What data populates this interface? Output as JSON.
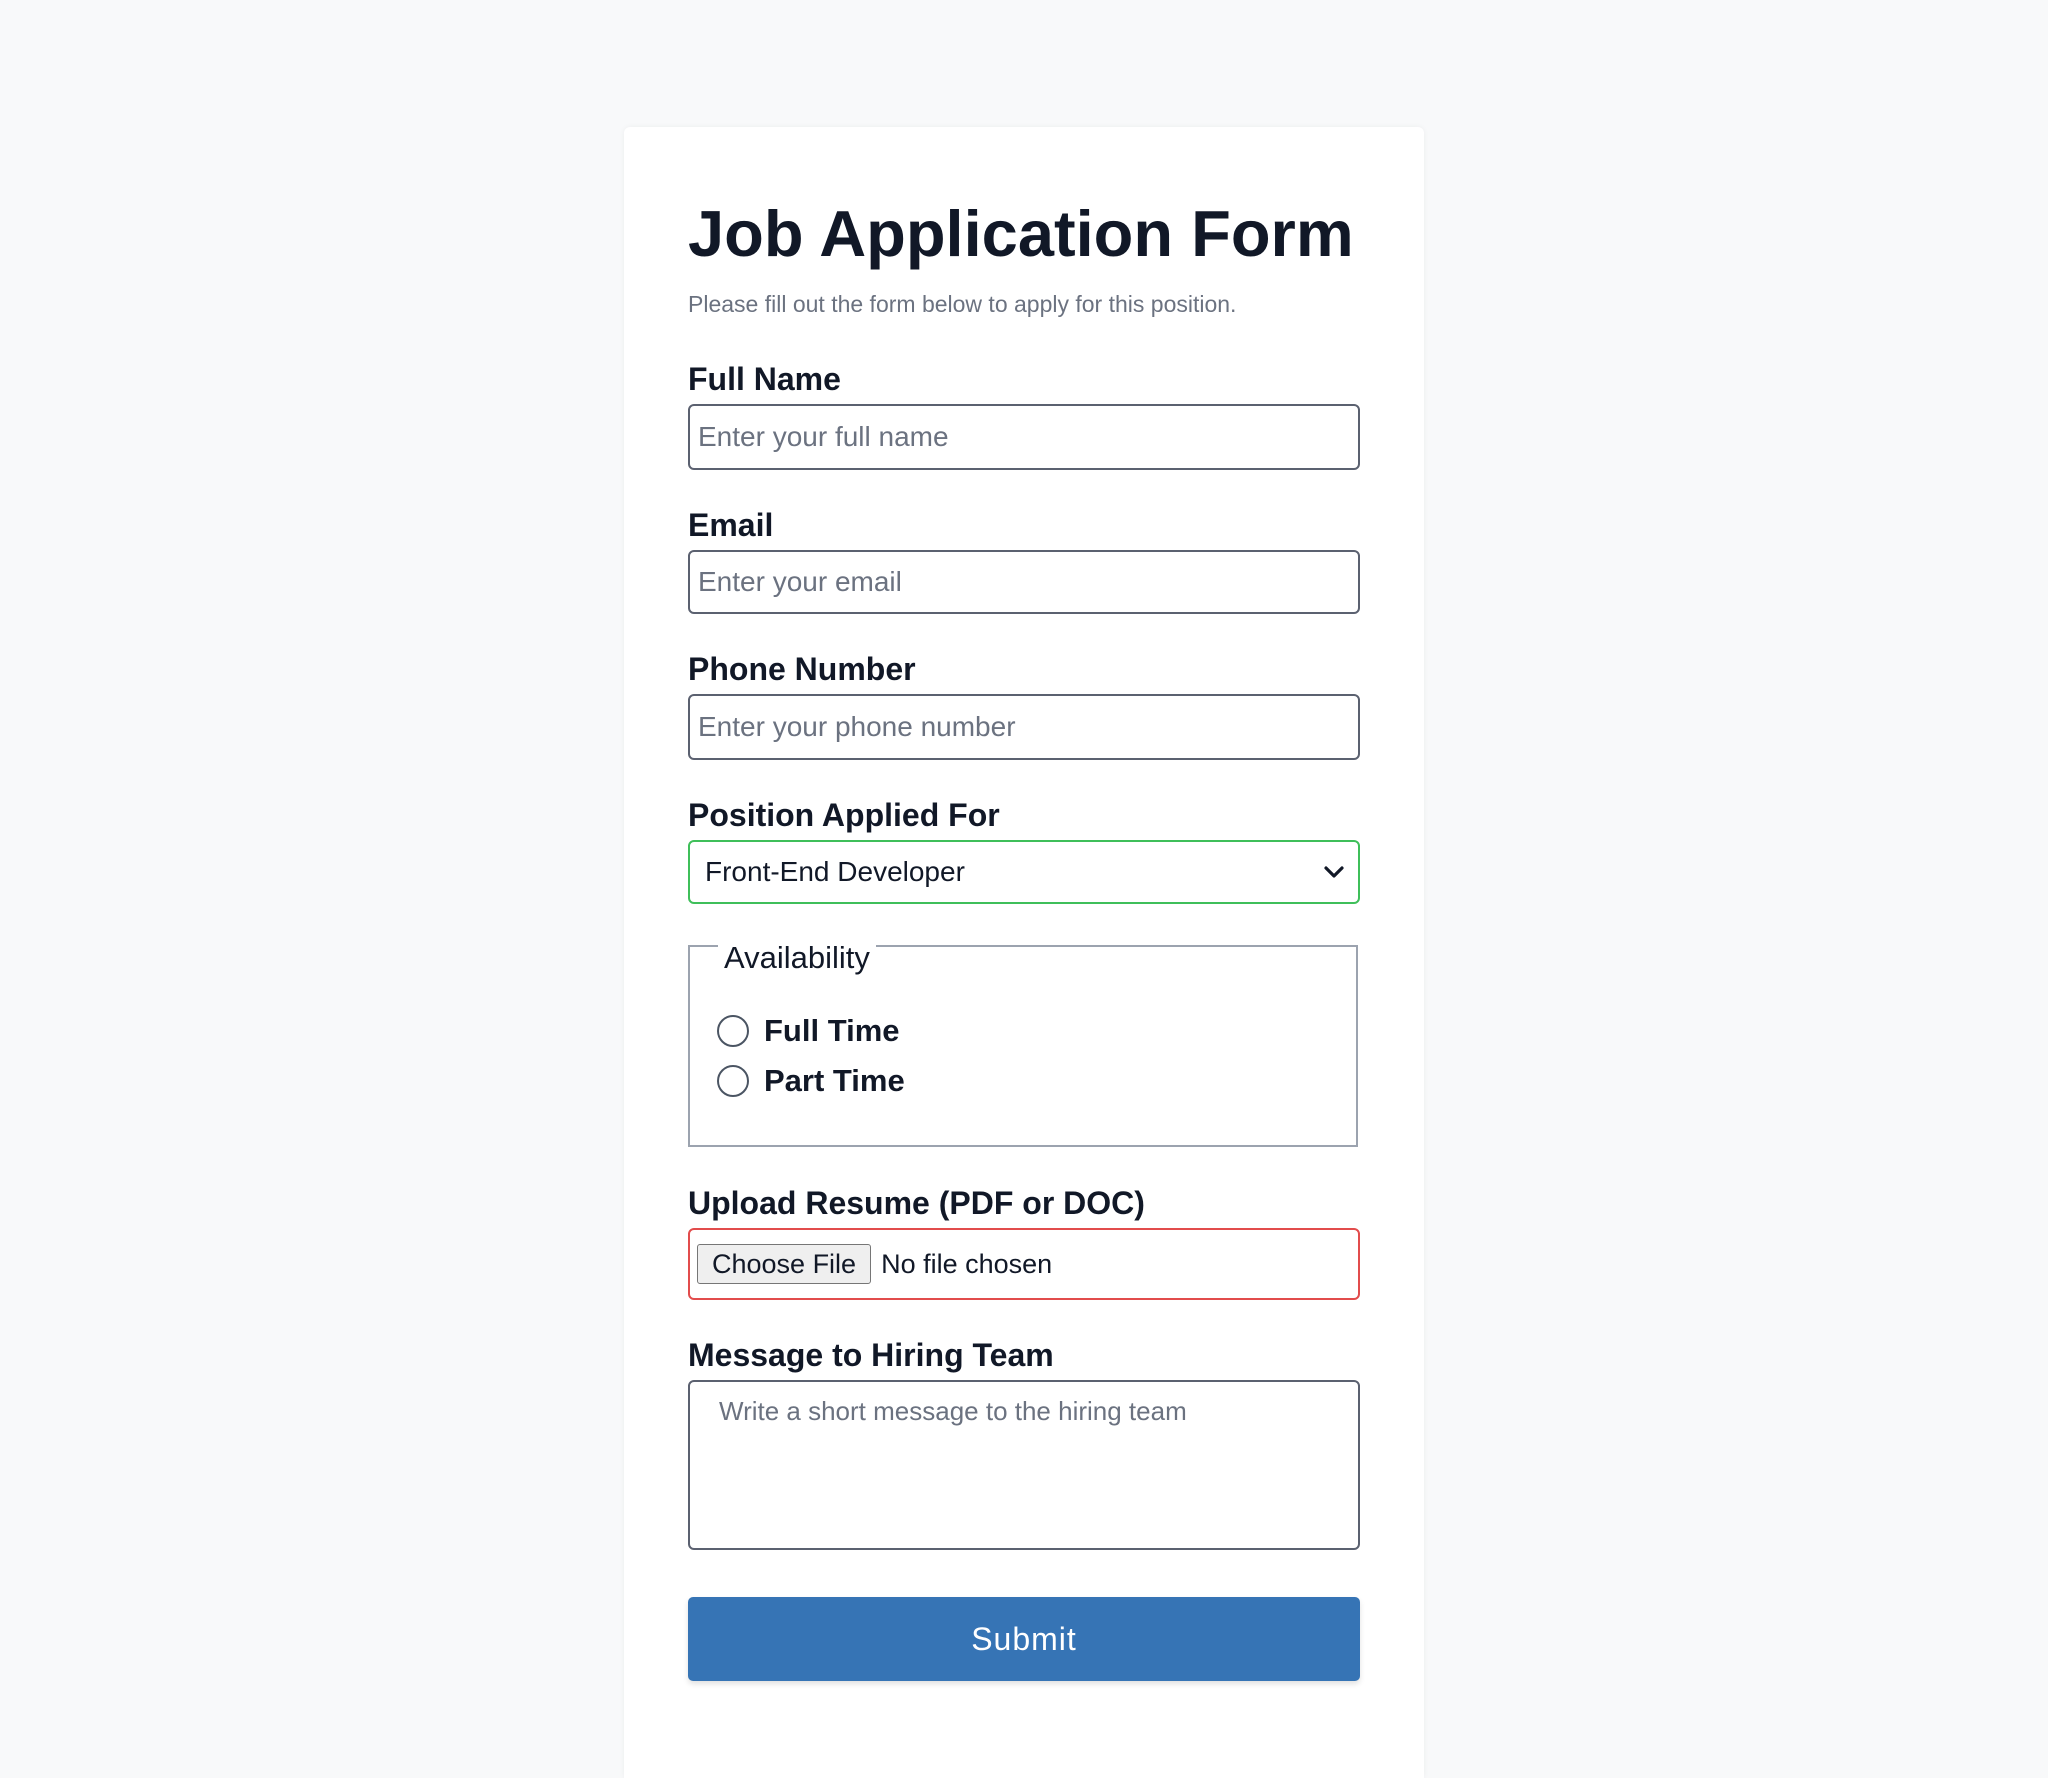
{
  "form": {
    "title": "Job Application Form",
    "subtitle": "Please fill out the form below to apply for this position.",
    "full_name": {
      "label": "Full Name",
      "placeholder": "Enter your full name"
    },
    "email": {
      "label": "Email",
      "placeholder": "Enter your email"
    },
    "phone": {
      "label": "Phone Number",
      "placeholder": "Enter your phone number"
    },
    "position": {
      "label": "Position Applied For",
      "selected": "Front-End Developer",
      "icon": "chevron-down-icon"
    },
    "availability": {
      "legend": "Availability",
      "options": [
        {
          "label": "Full Time",
          "checked": false
        },
        {
          "label": "Part Time",
          "checked": false
        }
      ]
    },
    "resume": {
      "label": "Upload Resume (PDF or DOC)",
      "button": "Choose File",
      "status": "No file chosen"
    },
    "message": {
      "label": "Message to Hiring Team",
      "placeholder": "Write a short message to the hiring team"
    },
    "submit_label": "Submit"
  },
  "colors": {
    "page_background": "#f8f9fa",
    "submit_background": "#3674b5",
    "select_border": "#3fbf5a",
    "file_border": "#e24c4c"
  }
}
